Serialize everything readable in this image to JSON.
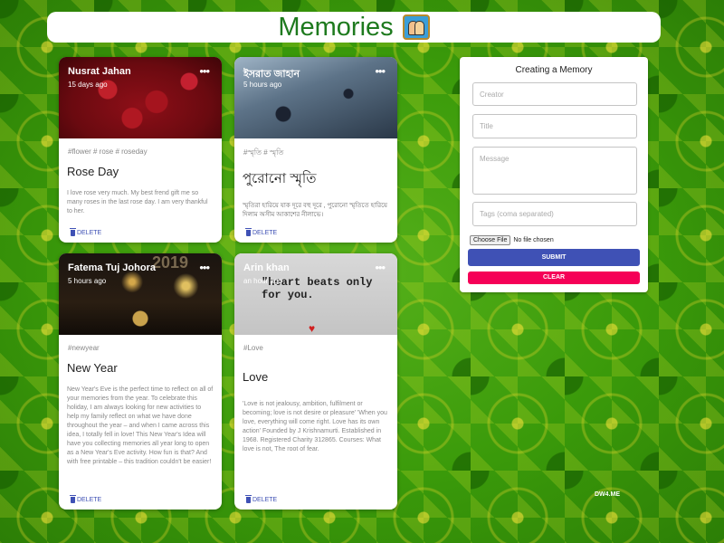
{
  "header": {
    "title": "Memories",
    "logo_icon": "memories-photo-icon"
  },
  "posts": [
    {
      "creator": "Nusrat Jahan",
      "time": "15 days ago",
      "tags": "#flower # rose # roseday",
      "title": "Rose Day",
      "message": "I love rose very much. My best frend gift me so many roses in the last rose day. I am very thankful to her.",
      "delete": "DELETE"
    },
    {
      "creator": "ইসরাত জাহান",
      "time": "5 hours ago",
      "tags": "#স্মৃতি # স্মৃতি",
      "title": "পুরোনো স্মৃতি",
      "message": "স্মৃতিরা হারিয়ে যাক দূরে বহু দূরে , পুরোনো স্মৃতিতে হারিয়ে দিলাম অসীম আকাশের নীলাভে।",
      "delete": "DELETE"
    },
    {
      "creator": "Fatema Tuj Johora",
      "time": "5 hours ago",
      "tags": "#newyear",
      "title": "New Year",
      "message": "New Year's Eve is the perfect time to reflect on all of your memories from the year. To celebrate this holiday, I am always looking for new activities to help my family reflect on what we have done throughout the year – and when I came across this idea, I totally fell in love! This New Year's Idea will have you collecting memories all year long to open as a New Year's Eve activity. How fun is that? And with free printable – this tradition couldn't be easier!",
      "delete": "DELETE",
      "image_text": "2019"
    },
    {
      "creator": "Arin khan",
      "time": "an hour ago",
      "tags": "#Love",
      "title": "Love",
      "message": "'Love is not jealousy, ambition, fulfilment or becoming; love is not desire or pleasure' 'When you love, everything will come right. Love has its own action' Founded by J Krishnamurti. Established in 1968. Registered Charity 312865. Courses: What love is not, The root of fear.",
      "delete": "DELETE",
      "image_text": "\"heart beats only for you."
    }
  ],
  "form": {
    "title": "Creating a Memory",
    "creator_placeholder": "Creator",
    "title_placeholder": "Title",
    "message_placeholder": "Message",
    "tags_placeholder": "Tags (coma separated)",
    "file_button": "Choose File",
    "file_status": "No file chosen",
    "submit": "SUBMIT",
    "clear": "CLEAR"
  },
  "watermark": "DW4.ME",
  "colors": {
    "primary": "#3f51b5",
    "secondary": "#f50057",
    "title_green": "#1e7a1e"
  }
}
